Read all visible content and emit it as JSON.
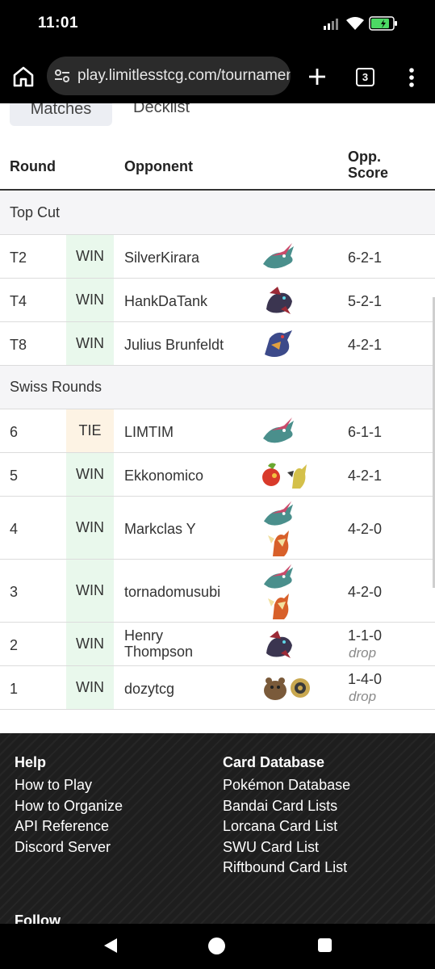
{
  "status_bar": {
    "time": "11:01"
  },
  "browser": {
    "url": "play.limitlesstcg.com/tournaments",
    "tab_count": "3"
  },
  "page_tabs": {
    "matches": "Matches",
    "decklist": "Decklist"
  },
  "table": {
    "headers": {
      "round": "Round",
      "opponent": "Opponent",
      "score_line1": "Opp.",
      "score_line2": "Score"
    },
    "groups": [
      {
        "label": "Top Cut"
      },
      {
        "label": "Swiss Rounds"
      }
    ],
    "rows": [
      {
        "round": "T2",
        "result": "WIN",
        "opponent": "SilverKirara",
        "score": "6-2-1"
      },
      {
        "round": "T4",
        "result": "WIN",
        "opponent": "HankDaTank",
        "score": "5-2-1"
      },
      {
        "round": "T8",
        "result": "WIN",
        "opponent": "Julius Brunfeldt",
        "score": "4-2-1"
      },
      {
        "round": "6",
        "result": "TIE",
        "opponent": "LIMTIM",
        "score": "6-1-1"
      },
      {
        "round": "5",
        "result": "WIN",
        "opponent": "Ekkonomico",
        "score": "4-2-1"
      },
      {
        "round": "4",
        "result": "WIN",
        "opponent": "Markclas Y",
        "score": "4-2-0"
      },
      {
        "round": "3",
        "result": "WIN",
        "opponent": "tornadomusubi",
        "score": "4-2-0"
      },
      {
        "round": "2",
        "result": "WIN",
        "opponent_line1": "Henry",
        "opponent_line2": "Thompson",
        "score": "1-1-0",
        "note": "drop"
      },
      {
        "round": "1",
        "result": "WIN",
        "opponent": "dozytcg",
        "score": "1-4-0",
        "note": "drop"
      }
    ],
    "colors": {
      "win_bg": "#e9f8ec",
      "tie_bg": "#fdf3e4"
    }
  },
  "footer": {
    "help_title": "Help",
    "help_links": [
      "How to Play",
      "How to Organize",
      "API Reference",
      "Discord Server"
    ],
    "cards_title": "Card Database",
    "cards_links": [
      "Pokémon Database",
      "Bandai Card Lists",
      "Lorcana Card List",
      "SWU Card List",
      "Riftbound Card List"
    ],
    "follow_title": "Follow"
  }
}
